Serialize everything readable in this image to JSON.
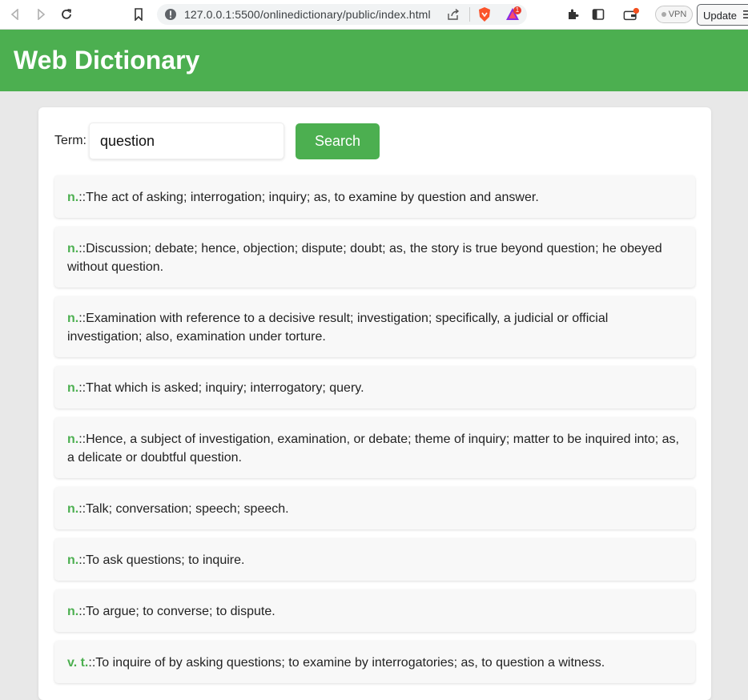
{
  "browser": {
    "url": "127.0.0.1:5500/onlinedictionary/public/index.html",
    "vpn_label": "VPN",
    "update_label": "Update",
    "notification_badge": "1"
  },
  "header": {
    "title": "Web Dictionary"
  },
  "search": {
    "term_label": "Term:",
    "value": "question",
    "button_label": "Search"
  },
  "results": [
    {
      "pos": "n.",
      "sep": "::",
      "text": "The act of asking; interrogation; inquiry; as, to examine by question and answer."
    },
    {
      "pos": "n.",
      "sep": "::",
      "text": "Discussion; debate; hence, objection; dispute; doubt; as, the story is true beyond question; he obeyed without question."
    },
    {
      "pos": "n.",
      "sep": "::",
      "text": "Examination with reference to a decisive result; investigation; specifically, a judicial or official investigation; also, examination under torture."
    },
    {
      "pos": "n.",
      "sep": "::",
      "text": "That which is asked; inquiry; interrogatory; query."
    },
    {
      "pos": "n.",
      "sep": "::",
      "text": "Hence, a subject of investigation, examination, or debate; theme of inquiry; matter to be inquired into; as, a delicate or doubtful question."
    },
    {
      "pos": "n.",
      "sep": "::",
      "text": "Talk; conversation; speech; speech."
    },
    {
      "pos": "n.",
      "sep": "::",
      "text": "To ask questions; to inquire."
    },
    {
      "pos": "n.",
      "sep": "::",
      "text": "To argue; to converse; to dispute."
    },
    {
      "pos": "v. t.",
      "sep": "::",
      "text": "To inquire of by asking questions; to examine by interrogatories; as, to question a witness."
    }
  ],
  "colors": {
    "accent": "#4caf50",
    "page_bg": "#e8e8e8",
    "item_bg": "#f8f8f8"
  }
}
